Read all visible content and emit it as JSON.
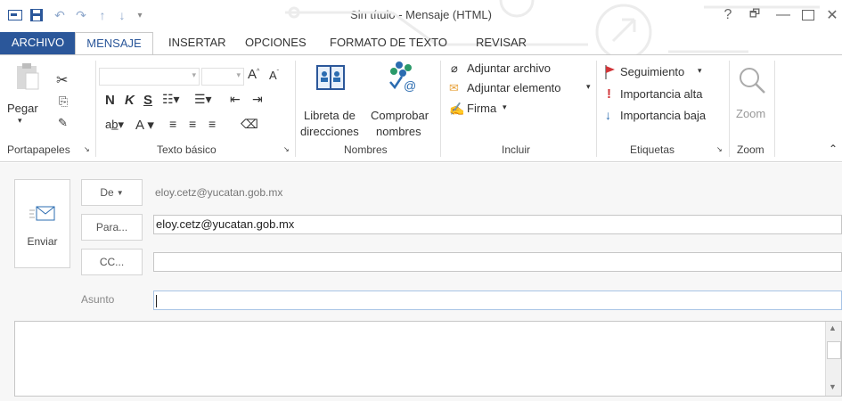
{
  "window": {
    "title": "Sin título - Mensaje (HTML)",
    "help": "?",
    "restore_glyph": "🗗",
    "minimize": "—",
    "close": "✕"
  },
  "tabs": [
    "ARCHIVO",
    "MENSAJE",
    "INSERTAR",
    "OPCIONES",
    "FORMATO DE TEXTO",
    "REVISAR"
  ],
  "ribbon": {
    "clipboard": {
      "paste": "Pegar",
      "label": "Portapapeles"
    },
    "basic_text": {
      "bold": "N",
      "italic": "K",
      "underline": "S",
      "label": "Texto básico"
    },
    "names": {
      "address_book_l1": "Libreta de",
      "address_book_l2": "direcciones",
      "check_names_l1": "Comprobar",
      "check_names_l2": "nombres",
      "label": "Nombres"
    },
    "include": {
      "attach_file": "Adjuntar archivo",
      "attach_item": "Adjuntar elemento",
      "signature": "Firma",
      "label": "Incluir"
    },
    "tags": {
      "follow_up": "Seguimiento",
      "high": "Importancia alta",
      "low": "Importancia baja",
      "label": "Etiquetas"
    },
    "zoom": {
      "button": "Zoom",
      "label": "Zoom"
    }
  },
  "compose": {
    "from_button": "De",
    "from_value": "eloy.cetz@yucatan.gob.mx",
    "send": "Enviar",
    "to_button": "Para...",
    "to_value": "eloy.cetz@yucatan.gob.mx",
    "cc_button": "CC...",
    "cc_value": "",
    "subject_label": "Asunto",
    "subject_value": "",
    "body": ""
  },
  "colors": {
    "accent": "#2b579a",
    "flag": "#d13438",
    "importance_high": "#d13438",
    "importance_low": "#2b6cb0"
  }
}
